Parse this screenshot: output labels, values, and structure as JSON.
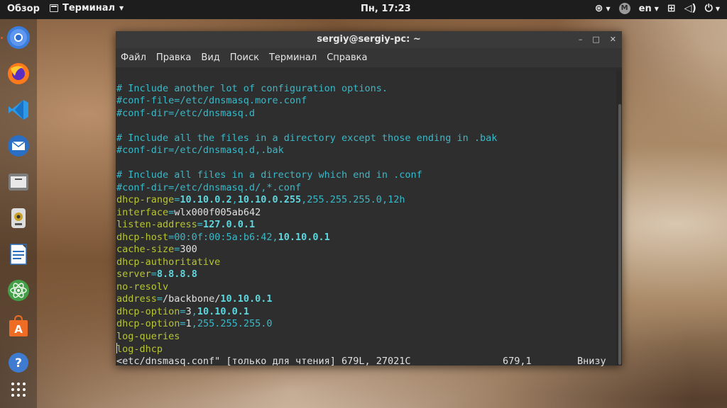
{
  "topbar": {
    "overview": "Обзор",
    "app_name": "Терминал",
    "clock": "Пн, 17:23",
    "lang": "en",
    "avatar_letter": "M"
  },
  "dock": {
    "items": [
      "chromium-icon",
      "firefox-icon",
      "vscode-icon",
      "mail-icon",
      "files-icon",
      "sound-icon",
      "writer-icon",
      "atom-icon",
      "software-center-icon",
      "help-icon",
      "apps-grid-icon"
    ]
  },
  "window": {
    "title": "sergiy@sergiy-pc: ~",
    "menu": [
      "Файл",
      "Правка",
      "Вид",
      "Поиск",
      "Терминал",
      "Справка"
    ]
  },
  "terminal": {
    "lines": [
      {
        "type": "blank"
      },
      {
        "type": "comment",
        "text": "# Include another lot of configuration options."
      },
      {
        "type": "comment",
        "text": "#conf-file=/etc/dnsmasq.more.conf"
      },
      {
        "type": "comment",
        "text": "#conf-dir=/etc/dnsmasq.d"
      },
      {
        "type": "blank"
      },
      {
        "type": "comment",
        "text": "# Include all the files in a directory except those ending in .bak"
      },
      {
        "type": "comment",
        "text": "#conf-dir=/etc/dnsmasq.d,.bak"
      },
      {
        "type": "blank"
      },
      {
        "type": "comment",
        "text": "# Include all files in a directory which end in .conf"
      },
      {
        "type": "comment",
        "text": "#conf-dir=/etc/dnsmasq.d/,*.conf"
      },
      {
        "type": "kv",
        "parts": [
          [
            "k",
            "dhcp-range"
          ],
          [
            "c",
            "="
          ],
          [
            "ip",
            "10.10.0.2"
          ],
          [
            "c",
            ","
          ],
          [
            "ip",
            "10.10.0.255"
          ],
          [
            "c",
            ","
          ],
          [
            "c",
            "255.255.255.0"
          ],
          [
            "c",
            ","
          ],
          [
            "c",
            "12h"
          ]
        ]
      },
      {
        "type": "kv",
        "parts": [
          [
            "k",
            "interface"
          ],
          [
            "c",
            "="
          ],
          [
            "n",
            "wlx000f005ab642"
          ]
        ]
      },
      {
        "type": "kv",
        "parts": [
          [
            "k",
            "listen-address"
          ],
          [
            "c",
            "="
          ],
          [
            "ip",
            "127.0.0.1"
          ]
        ]
      },
      {
        "type": "kv",
        "parts": [
          [
            "k",
            "dhcp-host"
          ],
          [
            "c",
            "="
          ],
          [
            "c",
            "00:0f:00:5a:b6:42"
          ],
          [
            "c",
            ","
          ],
          [
            "ip",
            "10.10.0.1"
          ]
        ]
      },
      {
        "type": "kv",
        "parts": [
          [
            "k",
            "cache-size"
          ],
          [
            "c",
            "="
          ],
          [
            "n",
            "300"
          ]
        ]
      },
      {
        "type": "kv",
        "parts": [
          [
            "k",
            "dhcp-authoritative"
          ]
        ]
      },
      {
        "type": "kv",
        "parts": [
          [
            "k",
            "server"
          ],
          [
            "c",
            "="
          ],
          [
            "ip",
            "8.8.8.8"
          ]
        ]
      },
      {
        "type": "kv",
        "parts": [
          [
            "k",
            "no-resolv"
          ]
        ]
      },
      {
        "type": "kv",
        "parts": [
          [
            "k",
            "address"
          ],
          [
            "c",
            "="
          ],
          [
            "n",
            "/backbone/"
          ],
          [
            "ip",
            "10.10.0.1"
          ]
        ]
      },
      {
        "type": "kv",
        "parts": [
          [
            "k",
            "dhcp-option"
          ],
          [
            "c",
            "="
          ],
          [
            "n",
            "3"
          ],
          [
            "c",
            ","
          ],
          [
            "ip",
            "10.10.0.1"
          ]
        ]
      },
      {
        "type": "kv",
        "parts": [
          [
            "k",
            "dhcp-option"
          ],
          [
            "c",
            "="
          ],
          [
            "n",
            "1"
          ],
          [
            "c",
            ","
          ],
          [
            "c",
            "255.255.255.0"
          ]
        ]
      },
      {
        "type": "kv",
        "parts": [
          [
            "k",
            "log-queries"
          ]
        ]
      },
      {
        "type": "cursorline",
        "text": "log-dhcp"
      }
    ],
    "status": {
      "file": "<etc/dnsmasq.conf\" [только для чтения] 679L, 27021C",
      "position": "679,1",
      "scroll": "Внизу"
    }
  },
  "colors": {
    "comment": "#3bb8c8",
    "keyword": "#b7c533",
    "ip": "#5fd7df",
    "terminal_bg": "#2e2e2e"
  }
}
